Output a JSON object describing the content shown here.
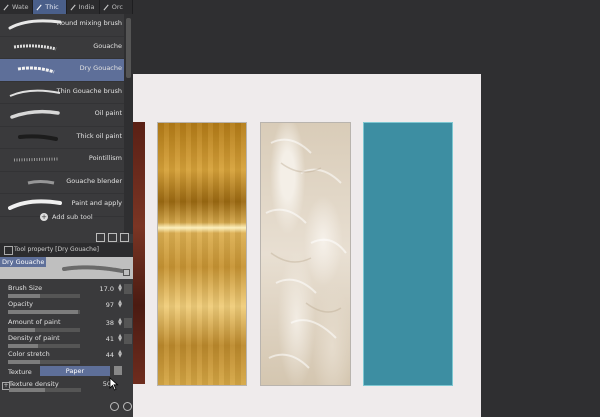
{
  "tabs": [
    {
      "label": "Wate",
      "active": false
    },
    {
      "label": "Thic",
      "active": true
    },
    {
      "label": "India",
      "active": false
    },
    {
      "label": "Orc",
      "active": false
    }
  ],
  "brushes": [
    {
      "label": "Round mixing brush"
    },
    {
      "label": "Gouache"
    },
    {
      "label": "Dry Gouache",
      "selected": true
    },
    {
      "label": "Thin Gouache brush"
    },
    {
      "label": "Oil paint"
    },
    {
      "label": "Thick oil paint"
    },
    {
      "label": "Pointillism"
    },
    {
      "label": "Gouache blender"
    },
    {
      "label": "Paint and apply"
    }
  ],
  "add_sub_tool": "Add sub tool",
  "tool_property": {
    "header": "Tool property [Dry Gouache]",
    "preset_name": "Dry Gouache",
    "properties": [
      {
        "label": "Brush Size",
        "value": "17.0",
        "fill": 0.45
      },
      {
        "label": "Opacity",
        "value": "97",
        "fill": 0.97
      },
      {
        "label": "Amount of paint",
        "value": "38",
        "fill": 0.38
      },
      {
        "label": "Density of paint",
        "value": "41",
        "fill": 0.41
      },
      {
        "label": "Color stretch",
        "value": "44",
        "fill": 0.44
      }
    ],
    "texture_label": "Texture",
    "texture_value": "Paper",
    "texture_density_label": "Texture density",
    "texture_density_value": "50"
  },
  "swatches": [
    {
      "name": "red-brown"
    },
    {
      "name": "gold"
    },
    {
      "name": "feather"
    },
    {
      "name": "teal",
      "color": "#3d8ea2"
    }
  ],
  "colors": {
    "accent": "#5e6f99",
    "panel": "#3a3a3c"
  }
}
